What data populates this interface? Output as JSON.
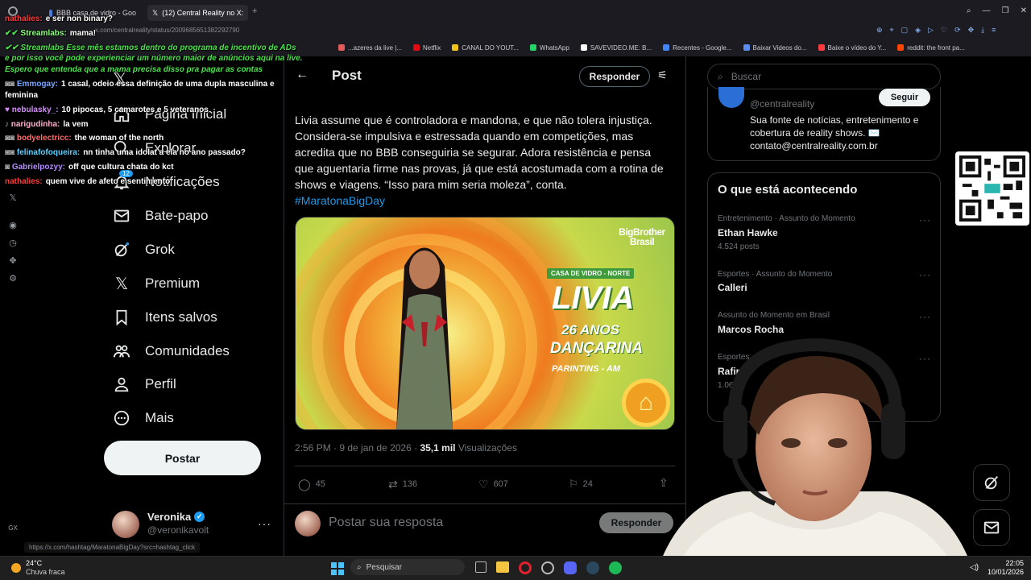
{
  "browser": {
    "tabs": [
      {
        "label": "BBB casa de vidro - Goo"
      },
      {
        "label": "(12) Central Reality no X:"
      }
    ],
    "address": "x.com/centralreality/status/2009685651382292790",
    "bookmarks": [
      "...azeres da live |...",
      "Netflix",
      "CANAL DO YOUT...",
      "WhatsApp",
      "SAVEVIDEO.ME: B...",
      "Recentes - Google...",
      "Baixar Videos do...",
      "Baixe o vídeo do Y...",
      "reddit: the front pa..."
    ],
    "status_url": "https://x.com/hashtag/MaratonaBigDay?src=hashtag_click"
  },
  "chat": [
    {
      "user": "nathalies:",
      "msg": "e ser non binary?",
      "color": "#ff3b3b"
    },
    {
      "user": "Streamlabs:",
      "msg": "mama!",
      "color": "#8aff7a"
    },
    {
      "user": "",
      "msg": "Streamlabs Esse mês estamos dentro do programa de incentivo de ADs",
      "color": "#4be14b"
    },
    {
      "user": "",
      "msg": "e por isso você pode experienciar um número maior de anúncios aqui na live.",
      "color": "#4be14b"
    },
    {
      "user": "",
      "msg": "Espero que entenda que a mama precisa disso pra pagar as contas",
      "color": "#4be14b"
    },
    {
      "user": "Emmogay:",
      "msg": "1 casal, odeio essa definição de uma dupla masculina e",
      "color": "#7aa8ff"
    },
    {
      "user": "",
      "msg": "feminina",
      "color": "#ffffff"
    },
    {
      "user": "nebulasky_:",
      "msg": "10 pipocas, 5 camarotes e 5 veteranos",
      "color": "#d78bff"
    },
    {
      "user": "narigudinha:",
      "msg": "la vem",
      "color": "#ffb0d0"
    },
    {
      "user": "nn",
      "msg": "the woman of the north",
      "color": "#ffffff"
    },
    {
      "user": "bodyelectricc:",
      "msg": "",
      "color": "#ff6b6b"
    },
    {
      "user": "felinafofoqueira:",
      "msg": "nn tinha uma idolat a ela no ano passado?",
      "color": "#5fd0ff"
    },
    {
      "user": "Gabrielpozyy:",
      "msg": "off que cultura chata do kct",
      "color": "#b28bff"
    },
    {
      "user": "nathalies:",
      "msg": "quem vive de afeto e sentimento",
      "color": "#ff3b3b"
    }
  ],
  "nav": {
    "items": [
      {
        "label": "Página Inicial",
        "icon": "home-icon"
      },
      {
        "label": "Explorar",
        "icon": "search-icon"
      },
      {
        "label": "Notificações",
        "icon": "bell-icon",
        "badge": "12"
      },
      {
        "label": "Bate-papo",
        "icon": "envelope-icon"
      },
      {
        "label": "Grok",
        "icon": "grok-icon"
      },
      {
        "label": "Premium",
        "icon": "x-logo-icon"
      },
      {
        "label": "Itens salvos",
        "icon": "bookmark-icon"
      },
      {
        "label": "Comunidades",
        "icon": "people-icon"
      },
      {
        "label": "Perfil",
        "icon": "person-icon"
      },
      {
        "label": "Mais",
        "icon": "more-circle-icon"
      }
    ],
    "post_button": "Postar",
    "profile": {
      "name": "Veronika",
      "handle": "@veronikavolt"
    }
  },
  "post": {
    "header_title": "Post",
    "reply_top": "Responder",
    "text": "Livia assume que é controladora e mandona, e que não tolera injustiça. Considera-se impulsiva e estressada quando em competições, mas acredita que no BBB conseguiria se segurar. Adora resistência e pensa que aguentaria firme nas provas, já que está acostumada com a rotina de shows e viagens. “Isso para mim seria moleza”, conta.",
    "hashtag": "#MaratonaBigDay",
    "image": {
      "brand": "BigBrother Brasil",
      "tag": "CASA DE VIDRO - NORTE",
      "name": "LIVIA",
      "age": "26 ANOS",
      "job": "DANÇARINA",
      "place": "PARINTINS - AM"
    },
    "time": "2:56 PM · 9 de jan de 2026 ·",
    "views": "35,1 mil",
    "views_label": "Visualizações",
    "stats": {
      "replies": "45",
      "reposts": "136",
      "likes": "607",
      "bookmarks": "24"
    },
    "reply_placeholder": "Postar sua resposta",
    "reply_button": "Responder"
  },
  "right": {
    "search_placeholder": "Buscar",
    "account": {
      "handle": "@centralreality",
      "follow": "Seguir",
      "bio": "Sua fonte de notícias, entretenimento e cobertura de reality shows. ✉️ contato@centralreality.com.br"
    },
    "trends_title": "O que está acontecendo",
    "trends": [
      {
        "category": "Entretenimento · Assunto do Momento",
        "name": "Ethan Hawke",
        "count": "4.524 posts"
      },
      {
        "category": "Esportes · Assunto do Momento",
        "name": "Calleri",
        "count": ""
      },
      {
        "category": "Assunto do Momento em Brasil",
        "name": "Marcos Rocha",
        "count": ""
      },
      {
        "category": "Esportes",
        "name": "Rafin",
        "count": "1.06"
      }
    ]
  },
  "taskbar": {
    "weather_temp": "24°C",
    "weather_desc": "Chuva fraca",
    "search": "Pesquisar",
    "time": "22:05",
    "date": "10/01/2026"
  }
}
